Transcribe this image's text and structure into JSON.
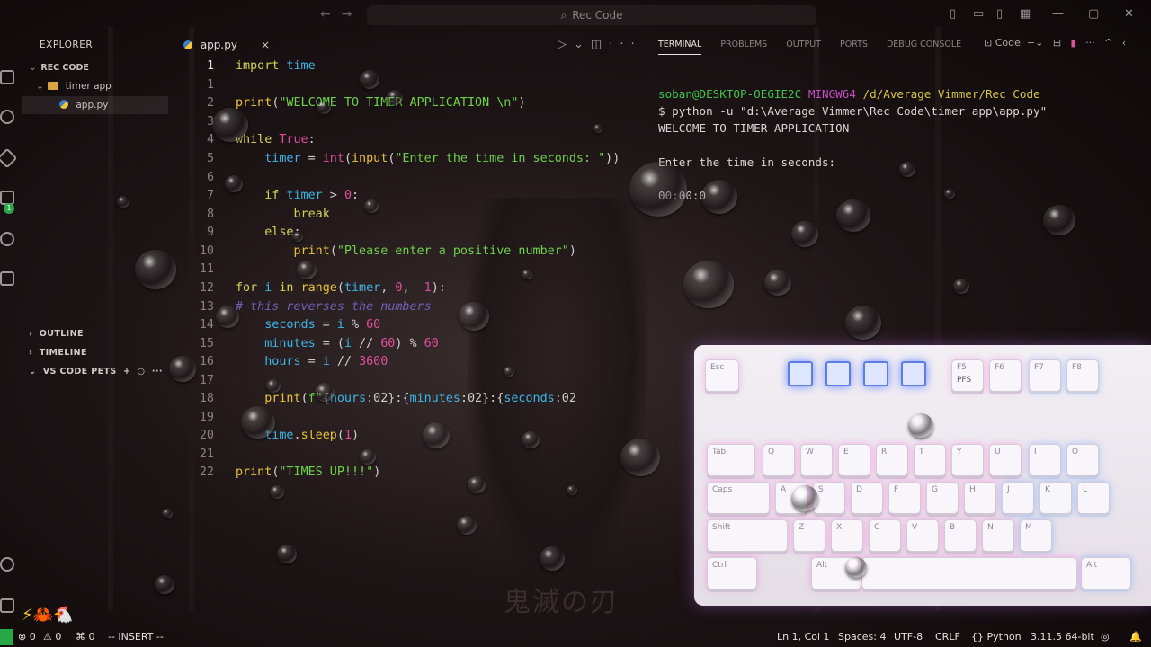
{
  "titlebar": {
    "search_text": "Rec Code"
  },
  "explorer": {
    "header": "EXPLORER",
    "root": "REC CODE",
    "folder": "timer app",
    "file": "app.py",
    "sections": [
      "OUTLINE",
      "TIMELINE",
      "VS CODE PETS"
    ]
  },
  "editor": {
    "tab_label": "app.py",
    "close_glyph": "×",
    "line_numbers": [
      "1",
      "1",
      "2",
      "3",
      "4",
      "5",
      "6",
      "7",
      "8",
      "9",
      "10",
      "11",
      "12",
      "13",
      "14",
      "15",
      "16",
      "17",
      "18",
      "19",
      "20",
      "21",
      "22"
    ]
  },
  "panel": {
    "tabs": [
      "TERMINAL",
      "PROBLEMS",
      "OUTPUT",
      "PORTS",
      "DEBUG CONSOLE"
    ],
    "shell_label": "Code",
    "terminal": {
      "prompt_user": "soban@DESKTOP-OEGIE2C",
      "prompt_shell": "MINGW64",
      "prompt_path": "/d/Average Vimmer/Rec Code",
      "command": "$ python -u \"d:\\Average Vimmer\\Rec Code\\timer app\\app.py\"",
      "out1": "WELCOME TO TIMER APPLICATION",
      "out2": "Enter the time in seconds:",
      "out3": "00:00:0"
    }
  },
  "statusbar": {
    "errors": "0",
    "warnings": "0",
    "ports": "0",
    "mode": "-- INSERT --",
    "cursor": "Ln 1, Col 1",
    "spaces": "Spaces: 4",
    "encoding": "UTF-8",
    "eol": "CRLF",
    "language": "Python",
    "version": "3.11.5 64-bit"
  },
  "wallpaper": {
    "kanji": "鬼滅の刃"
  },
  "keyboard": {
    "keys": [
      "Esc",
      "F5",
      "PFS",
      "F6",
      "F7",
      "F8",
      "Tab",
      "Q",
      "W",
      "E",
      "R",
      "T",
      "Y",
      "U",
      "I",
      "O",
      "Caps",
      "A",
      "S",
      "D",
      "F",
      "G",
      "H",
      "J",
      "K",
      "L",
      "Shift",
      "Z",
      "X",
      "C",
      "V",
      "B",
      "N",
      "M",
      "Ctrl",
      "Alt",
      "Alt"
    ]
  },
  "colors": {
    "keyword": "#d3d35a",
    "builtin": "#e04f9e",
    "string": "#6fd14a",
    "variable": "#3db5e6",
    "comment": "#6c62b8",
    "status_green": "#27a745"
  }
}
